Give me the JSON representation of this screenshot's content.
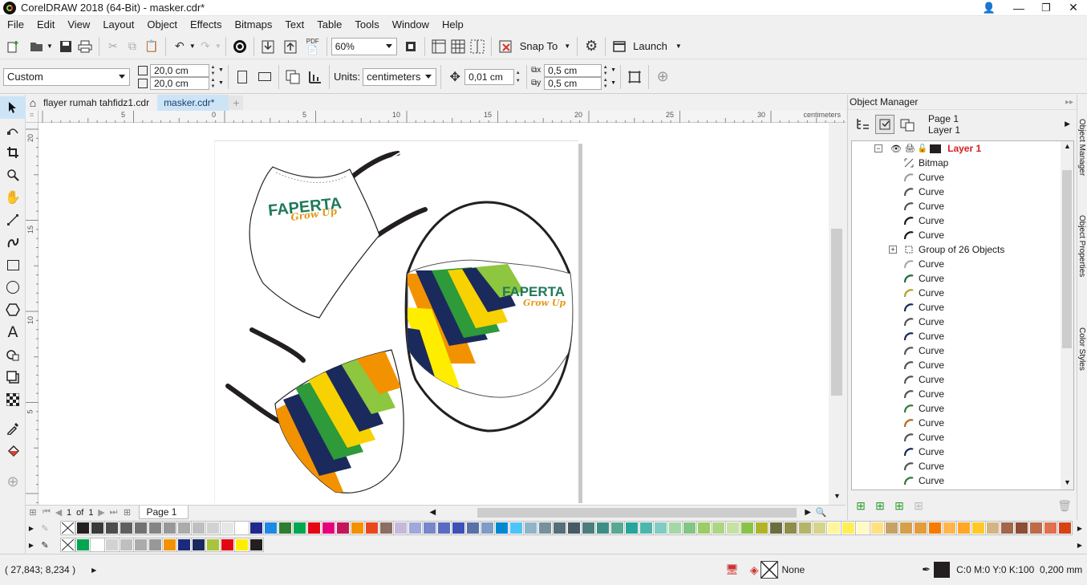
{
  "window": {
    "title": "CorelDRAW 2018 (64-Bit) - masker.cdr*"
  },
  "menu": [
    "File",
    "Edit",
    "View",
    "Layout",
    "Object",
    "Effects",
    "Bitmaps",
    "Text",
    "Table",
    "Tools",
    "Window",
    "Help"
  ],
  "standard_toolbar": {
    "zoom": "60%",
    "snap_label": "Snap To",
    "launch_label": "Launch"
  },
  "property_bar": {
    "page_preset": "Custom",
    "width": "20,0 cm",
    "height": "20,0 cm",
    "units_label": "Units:",
    "units": "centimeters",
    "nudge": "0,01 cm",
    "dup_x": "0,5 cm",
    "dup_y": "0,5 cm"
  },
  "doc_tabs": [
    "flayer rumah tahfidz1.cdr",
    "masker.cdr*"
  ],
  "ruler": {
    "h_labels": [
      "5",
      "0",
      "5",
      "10",
      "15",
      "20",
      "25",
      "30"
    ],
    "h_unit": "centimeters",
    "v_labels": [
      "20",
      "15",
      "10",
      "5"
    ]
  },
  "artwork": {
    "brand": "FAPERTA",
    "tagline": "Grow Up"
  },
  "page_nav": {
    "current": "1",
    "of_label": "of",
    "total": "1",
    "tab": "Page 1"
  },
  "object_manager": {
    "title": "Object Manager",
    "page": "Page 1",
    "layer": "Layer 1",
    "layer_name": "Layer 1",
    "items": [
      {
        "label": "Bitmap",
        "icon": "bitmap-icon",
        "color": "#555555"
      },
      {
        "label": "Curve",
        "icon": "curve-icon",
        "color": "#a0a0a0"
      },
      {
        "label": "Curve",
        "icon": "curve-icon",
        "color": "#555555"
      },
      {
        "label": "Curve",
        "icon": "curve-icon",
        "color": "#555555"
      },
      {
        "label": "Curve",
        "icon": "curve-icon",
        "color": "#1a1a1a"
      },
      {
        "label": "Curve",
        "icon": "curve-icon",
        "color": "#1a1a1a"
      },
      {
        "label": "Group of 26 Objects",
        "icon": "group-icon",
        "color": "#555555",
        "expandable": true
      },
      {
        "label": "Curve",
        "icon": "curve-icon",
        "color": "#aaaaaa"
      },
      {
        "label": "Curve",
        "icon": "curve-icon",
        "color": "#1f6b3a"
      },
      {
        "label": "Curve",
        "icon": "curve-icon",
        "color": "#b8a020"
      },
      {
        "label": "Curve",
        "icon": "curve-icon",
        "color": "#1b2a5c"
      },
      {
        "label": "Curve",
        "icon": "curve-icon",
        "color": "#555555"
      },
      {
        "label": "Curve",
        "icon": "curve-icon",
        "color": "#1b2a5c"
      },
      {
        "label": "Curve",
        "icon": "curve-icon",
        "color": "#555555"
      },
      {
        "label": "Curve",
        "icon": "curve-icon",
        "color": "#555555"
      },
      {
        "label": "Curve",
        "icon": "curve-icon",
        "color": "#555555"
      },
      {
        "label": "Curve",
        "icon": "curve-icon",
        "color": "#555555"
      },
      {
        "label": "Curve",
        "icon": "curve-icon",
        "color": "#2e7d32"
      },
      {
        "label": "Curve",
        "icon": "curve-icon",
        "color": "#b06a20"
      },
      {
        "label": "Curve",
        "icon": "curve-icon",
        "color": "#555555"
      },
      {
        "label": "Curve",
        "icon": "curve-icon",
        "color": "#1b2a5c"
      },
      {
        "label": "Curve",
        "icon": "curve-icon",
        "color": "#555555"
      },
      {
        "label": "Curve",
        "icon": "curve-icon",
        "color": "#2e7d32"
      }
    ]
  },
  "docker_tabs": [
    "Object Manager",
    "Object Properties",
    "Color Styles"
  ],
  "palette_main": [
    "#231f20",
    "#3a3a3a",
    "#4d4d4d",
    "#5f5f5f",
    "#727272",
    "#858585",
    "#989898",
    "#ababab",
    "#bfbfbf",
    "#d2d2d2",
    "#e6e6e6",
    "#ffffff",
    "#1f2a8c",
    "#1e88e5",
    "#2e7d32",
    "#00a651",
    "#e30613",
    "#e6007e",
    "#c2185b",
    "#f39200",
    "#e8481c",
    "#8d6e63",
    "#c5b8d8",
    "#9fa8da",
    "#7986cb",
    "#5c6bc0",
    "#3f51b5",
    "#5b6fa8",
    "#7e9cc4",
    "#0288d1",
    "#4fc3f7",
    "#90b4c8",
    "#78909c",
    "#546e7a",
    "#455a64",
    "#4c7d7e",
    "#3d8e86",
    "#5aa795",
    "#26a69a",
    "#4db6ac",
    "#80cbc4",
    "#a5d6a7",
    "#81c784",
    "#9ccc65",
    "#aed581",
    "#c5e1a5",
    "#8bc34a",
    "#afb42b",
    "#6d6d3c",
    "#8d8d4c",
    "#b4b46a",
    "#d4d48a",
    "#fff59d",
    "#ffee58",
    "#fff9c4",
    "#ffe082",
    "#c8a265",
    "#d4a04c",
    "#e49b3a",
    "#f57c00",
    "#ffb74d",
    "#ffa726",
    "#ffca28",
    "#d4b483",
    "#a1684a",
    "#8d4e33",
    "#bf6b4a",
    "#e07050",
    "#d84315"
  ],
  "palette_doc": [
    "#00a651",
    "#ffffff",
    "#d2d2d2",
    "#bfbfbf",
    "#ababab",
    "#989898",
    "#f39200",
    "#1b2a7c",
    "#1b2a5c",
    "#a8c43a",
    "#e30613",
    "#ffed00",
    "#231f20"
  ],
  "status": {
    "coords": "( 27,843; 8,234 )",
    "fill_label": "None",
    "outline_info": "C:0 M:0 Y:0 K:100  0,200 mm"
  }
}
